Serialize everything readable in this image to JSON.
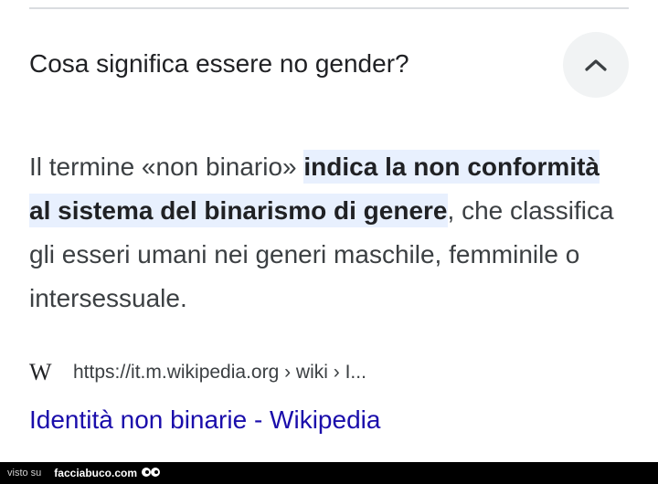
{
  "question": {
    "text": "Cosa significa essere no gender?",
    "toggle_icon": "chevron-up-icon"
  },
  "answer": {
    "intro": "Il termine «non binario» ",
    "highlight": "indica la non conformità al sistema del binarismo di genere",
    "rest": ", che classifica gli esseri umani nei generi maschile, femminile o intersessuale."
  },
  "source": {
    "logo_text": "W",
    "url": "https://it.m.wikipedia.org › wiki › I..."
  },
  "result": {
    "title": "Identità non binarie - Wikipedia"
  },
  "watermark": {
    "prefix": "visto su",
    "brand": "facciabuco.com"
  },
  "colors": {
    "link": "#1a0dab",
    "highlight_bg": "#e8f0fe",
    "button_bg": "#f1f3f4"
  }
}
